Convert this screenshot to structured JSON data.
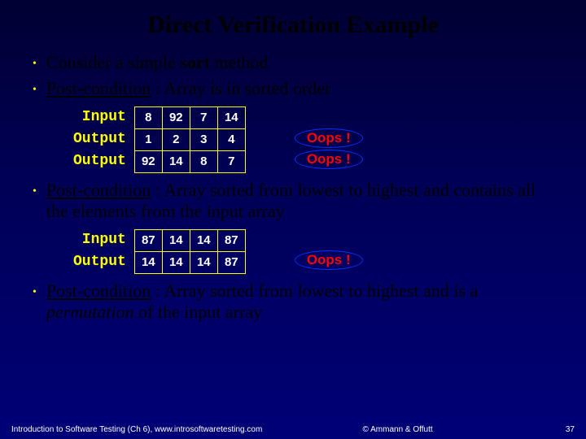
{
  "title": "Direct Verification Example",
  "bullets": {
    "b1_pre": "Consider a simple ",
    "b1_bold": "sort",
    "b1_post": " method",
    "b2_label": "Post-condition",
    "b2_rest": " : Array is in sorted order",
    "b3_label": "Post-condition",
    "b3_rest": " : Array sorted from lowest to highest and contains all the elements from the input array",
    "b4_label": "Post-condition",
    "b4_rest_a": " : Array sorted from lowest to highest and is a ",
    "b4_italic": "permutation",
    "b4_rest_b": " of the input array"
  },
  "example1": {
    "labels": [
      "Input",
      "Output",
      "Output"
    ],
    "rows": [
      [
        "8",
        "92",
        "7",
        "14"
      ],
      [
        "1",
        "2",
        "3",
        "4"
      ],
      [
        "92",
        "14",
        "8",
        "7"
      ]
    ],
    "oops": [
      "Oops !",
      "Oops !"
    ]
  },
  "example2": {
    "labels": [
      "Input",
      "Output"
    ],
    "rows": [
      [
        "87",
        "14",
        "14",
        "87"
      ],
      [
        "14",
        "14",
        "14",
        "87"
      ]
    ],
    "oops": [
      "Oops !"
    ]
  },
  "footer": {
    "left": "Introduction to Software Testing (Ch 6), www.introsoftwaretesting.com",
    "center": "© Ammann & Offutt",
    "page": "37"
  }
}
